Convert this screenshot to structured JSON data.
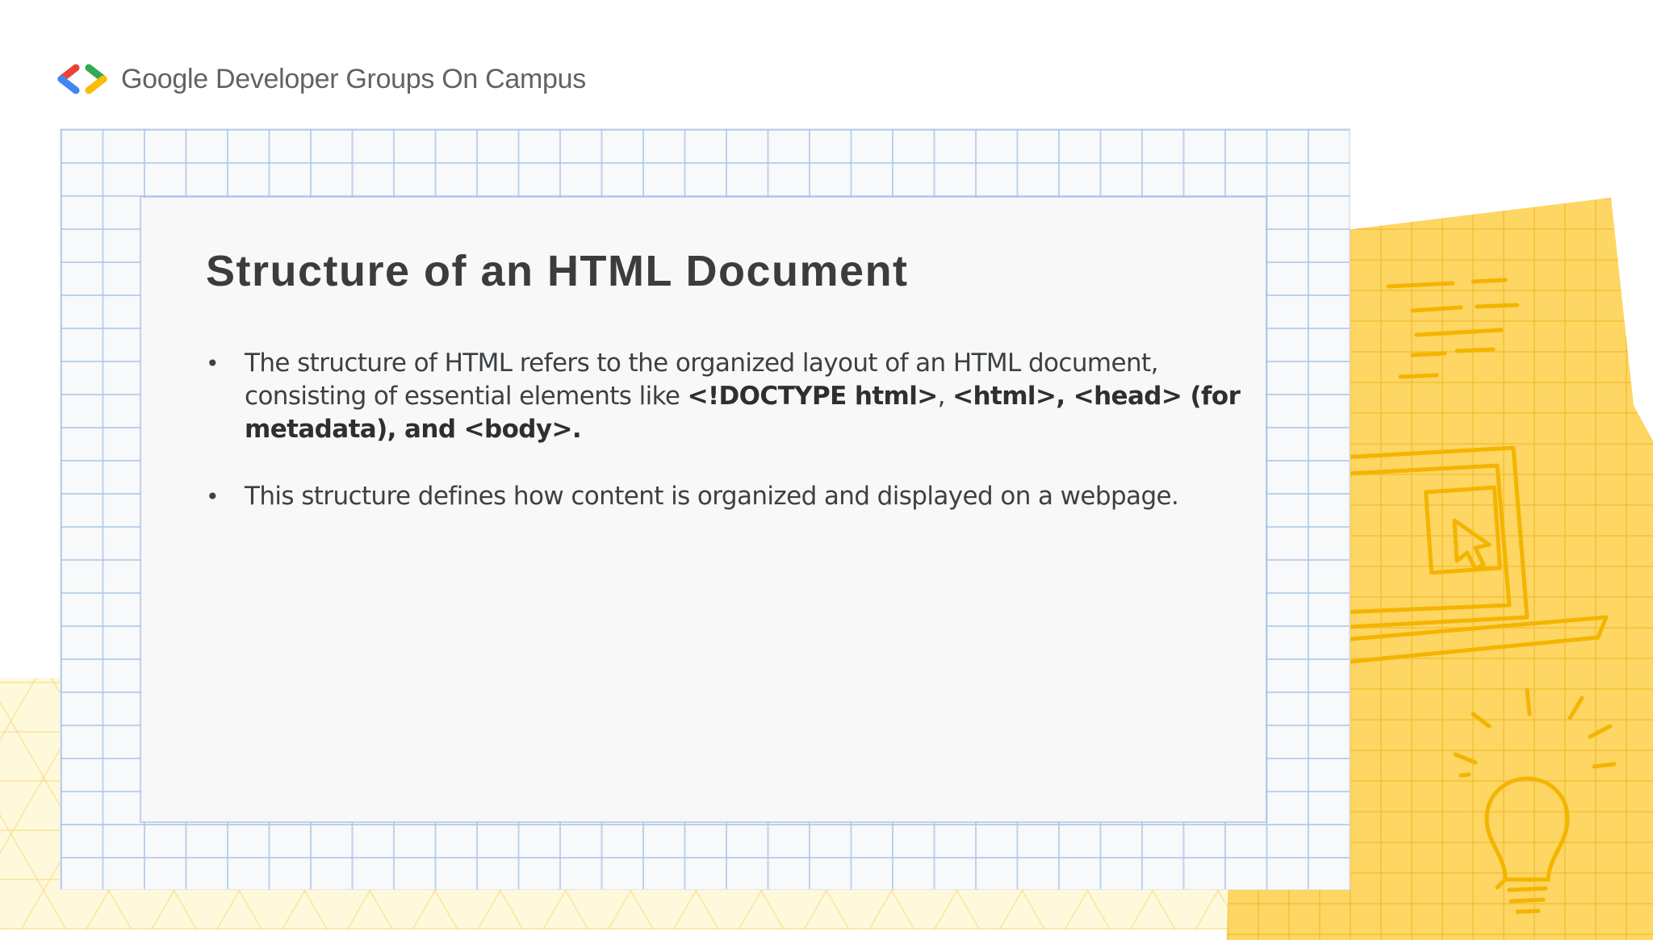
{
  "brand": {
    "name": "Google Developer Groups On Campus",
    "colors": {
      "red": "#ea4335",
      "blue": "#4285f4",
      "green": "#34a853",
      "yellow": "#fbbc04"
    }
  },
  "slide": {
    "title": "Structure of an HTML Document",
    "bullets": [
      {
        "parts": [
          {
            "text": "The structure of HTML refers to the organized layout of an HTML document, consisting of essential elements like ",
            "bold": false
          },
          {
            "text": "<!DOCTYPE html>",
            "bold": true
          },
          {
            "text": ", ",
            "bold": false
          },
          {
            "text": "<html>, <head> (for metadata), and <body>.",
            "bold": true
          }
        ]
      },
      {
        "parts": [
          {
            "text": "This structure defines how content is organized and displayed on a webpage.",
            "bold": false
          }
        ]
      }
    ]
  },
  "decorations": {
    "illustration": [
      "laptop-illustration",
      "cursor-icon",
      "lightbulb-icon"
    ],
    "paper_color": "#fdd663",
    "grid_color": "#aac4e8"
  }
}
